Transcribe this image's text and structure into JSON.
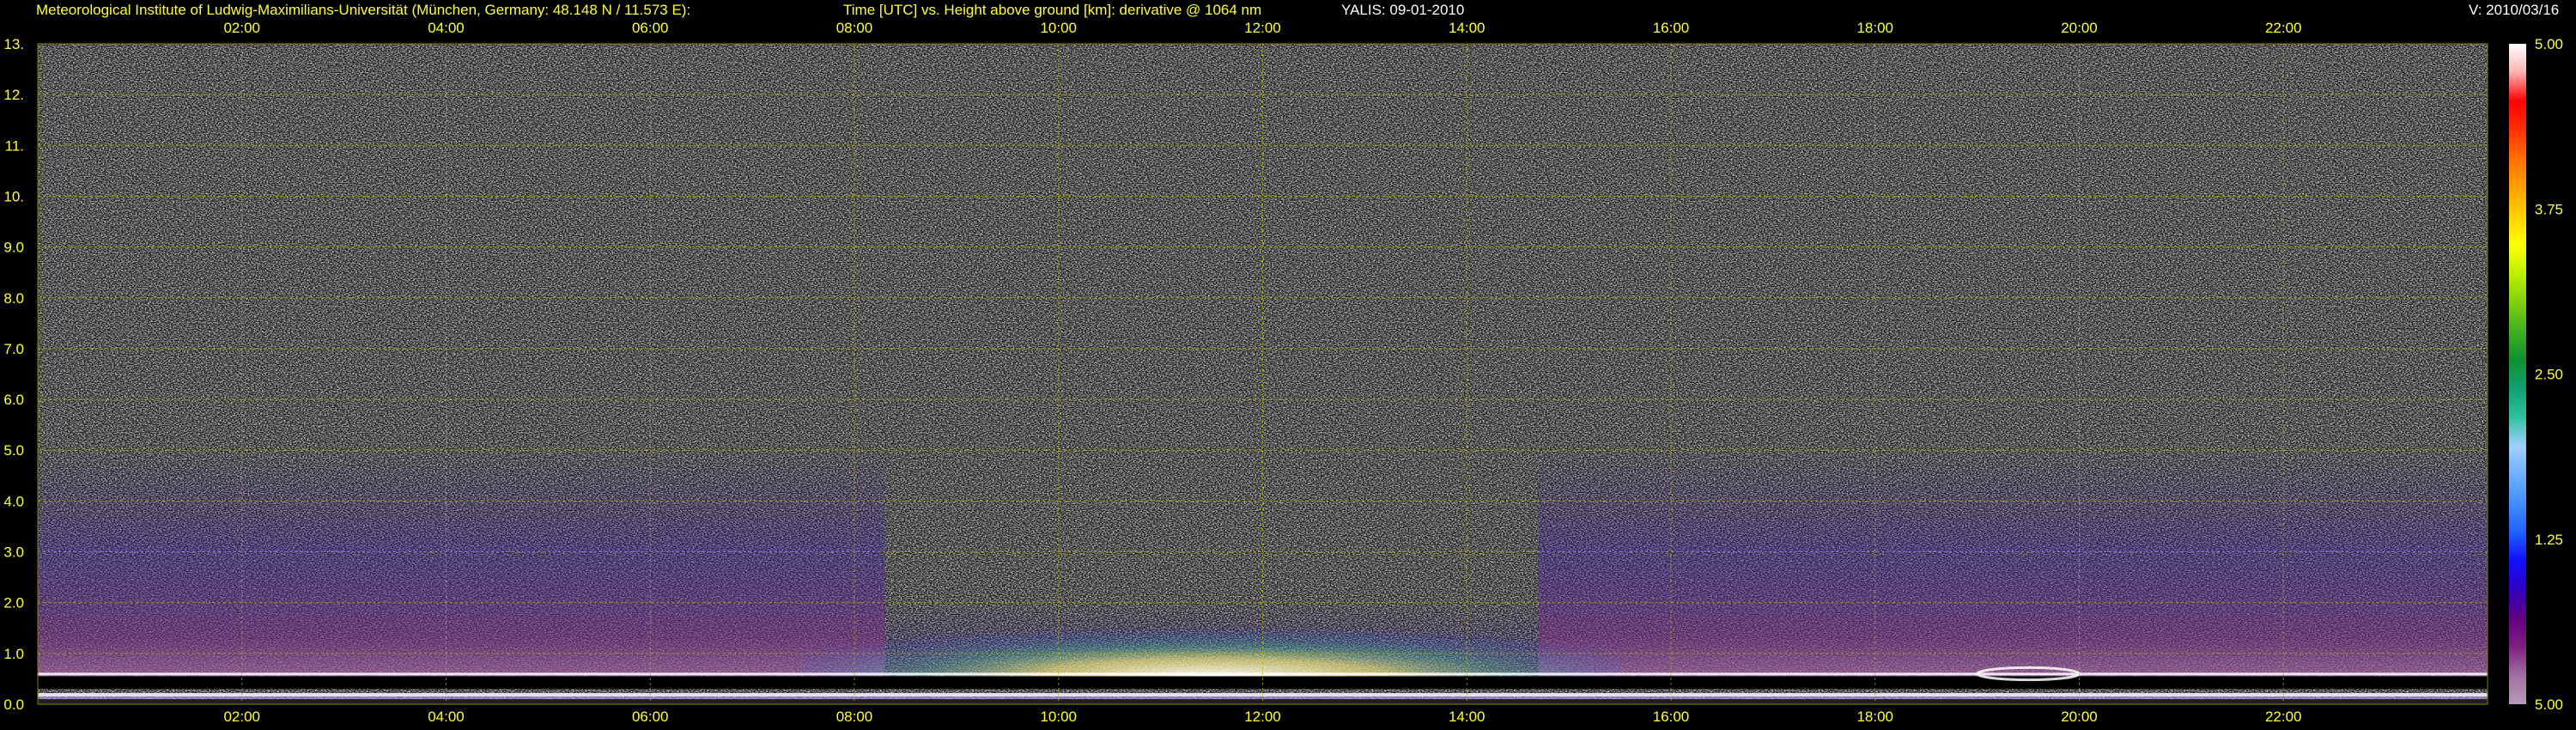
{
  "header": {
    "institute": "Meteorological Institute of Ludwig-Maximilians-Universität (München, Germany: 48.148 N / 11.573 E):",
    "plot_title": "Time [UTC] vs. Height above ground [km]: derivative @ 1064 nm",
    "instrument": "YALIS: 09-01-2010",
    "version": "V: 2010/03/16"
  },
  "chart_data": {
    "type": "heatmap",
    "title": "Time [UTC] vs. Height above ground [km]: derivative @ 1064 nm",
    "xlabel": "Time [UTC]",
    "ylabel": "Height above ground [km]",
    "xlim": [
      0,
      24
    ],
    "ylim": [
      0,
      13
    ],
    "x_ticks": [
      {
        "value": 2,
        "label": "02:00"
      },
      {
        "value": 4,
        "label": "04:00"
      },
      {
        "value": 6,
        "label": "06:00"
      },
      {
        "value": 8,
        "label": "08:00"
      },
      {
        "value": 10,
        "label": "10:00"
      },
      {
        "value": 12,
        "label": "12:00"
      },
      {
        "value": 14,
        "label": "14:00"
      },
      {
        "value": 16,
        "label": "16:00"
      },
      {
        "value": 18,
        "label": "18:00"
      },
      {
        "value": 20,
        "label": "20:00"
      },
      {
        "value": 22,
        "label": "22:00"
      }
    ],
    "y_ticks": [
      {
        "value": 0,
        "label": "0.0"
      },
      {
        "value": 1,
        "label": "1.0"
      },
      {
        "value": 2,
        "label": "2.0"
      },
      {
        "value": 3,
        "label": "3.0"
      },
      {
        "value": 4,
        "label": "4.0"
      },
      {
        "value": 5,
        "label": "5.0"
      },
      {
        "value": 6,
        "label": "6.0"
      },
      {
        "value": 7,
        "label": "7.0"
      },
      {
        "value": 8,
        "label": "8.0"
      },
      {
        "value": 9,
        "label": "9.0"
      },
      {
        "value": 10,
        "label": "10."
      },
      {
        "value": 11,
        "label": "11."
      },
      {
        "value": 12,
        "label": "12."
      },
      {
        "value": 13,
        "label": "13."
      }
    ],
    "grid": true,
    "grid_color": "#b5b500",
    "colorbar": {
      "range": [
        0,
        5
      ],
      "ticks": [
        {
          "value": 5.0,
          "label": "5.00"
        },
        {
          "value": 3.75,
          "label": "3.75"
        },
        {
          "value": 2.5,
          "label": "2.50"
        },
        {
          "value": 1.25,
          "label": "1.25"
        },
        {
          "value": 0.0,
          "label": "5.00"
        }
      ],
      "colors": [
        "#b89ab8",
        "#a070a0",
        "#802080",
        "#600080",
        "#3000c0",
        "#1010ff",
        "#2060ff",
        "#4090ff",
        "#70b0ff",
        "#a0d0ff",
        "#30c0a0",
        "#10a070",
        "#109030",
        "#40b020",
        "#80d010",
        "#c0f000",
        "#ffff00",
        "#ffd000",
        "#ffa000",
        "#ff7000",
        "#ff3000",
        "#ff0000",
        "#ffb0b0",
        "#ffffff"
      ]
    },
    "features": {
      "noise_above_km": 2.0,
      "aerosol_layer_top_km": 3.5,
      "mixing_layer_peak": {
        "time": 11.5,
        "height_km": 1.0
      },
      "bright_core_period": [
        9.5,
        13.5
      ],
      "overlap_band_km": [
        0.3,
        0.55
      ],
      "late_feature": {
        "time": 19.5,
        "height_km": 0.6
      }
    }
  }
}
